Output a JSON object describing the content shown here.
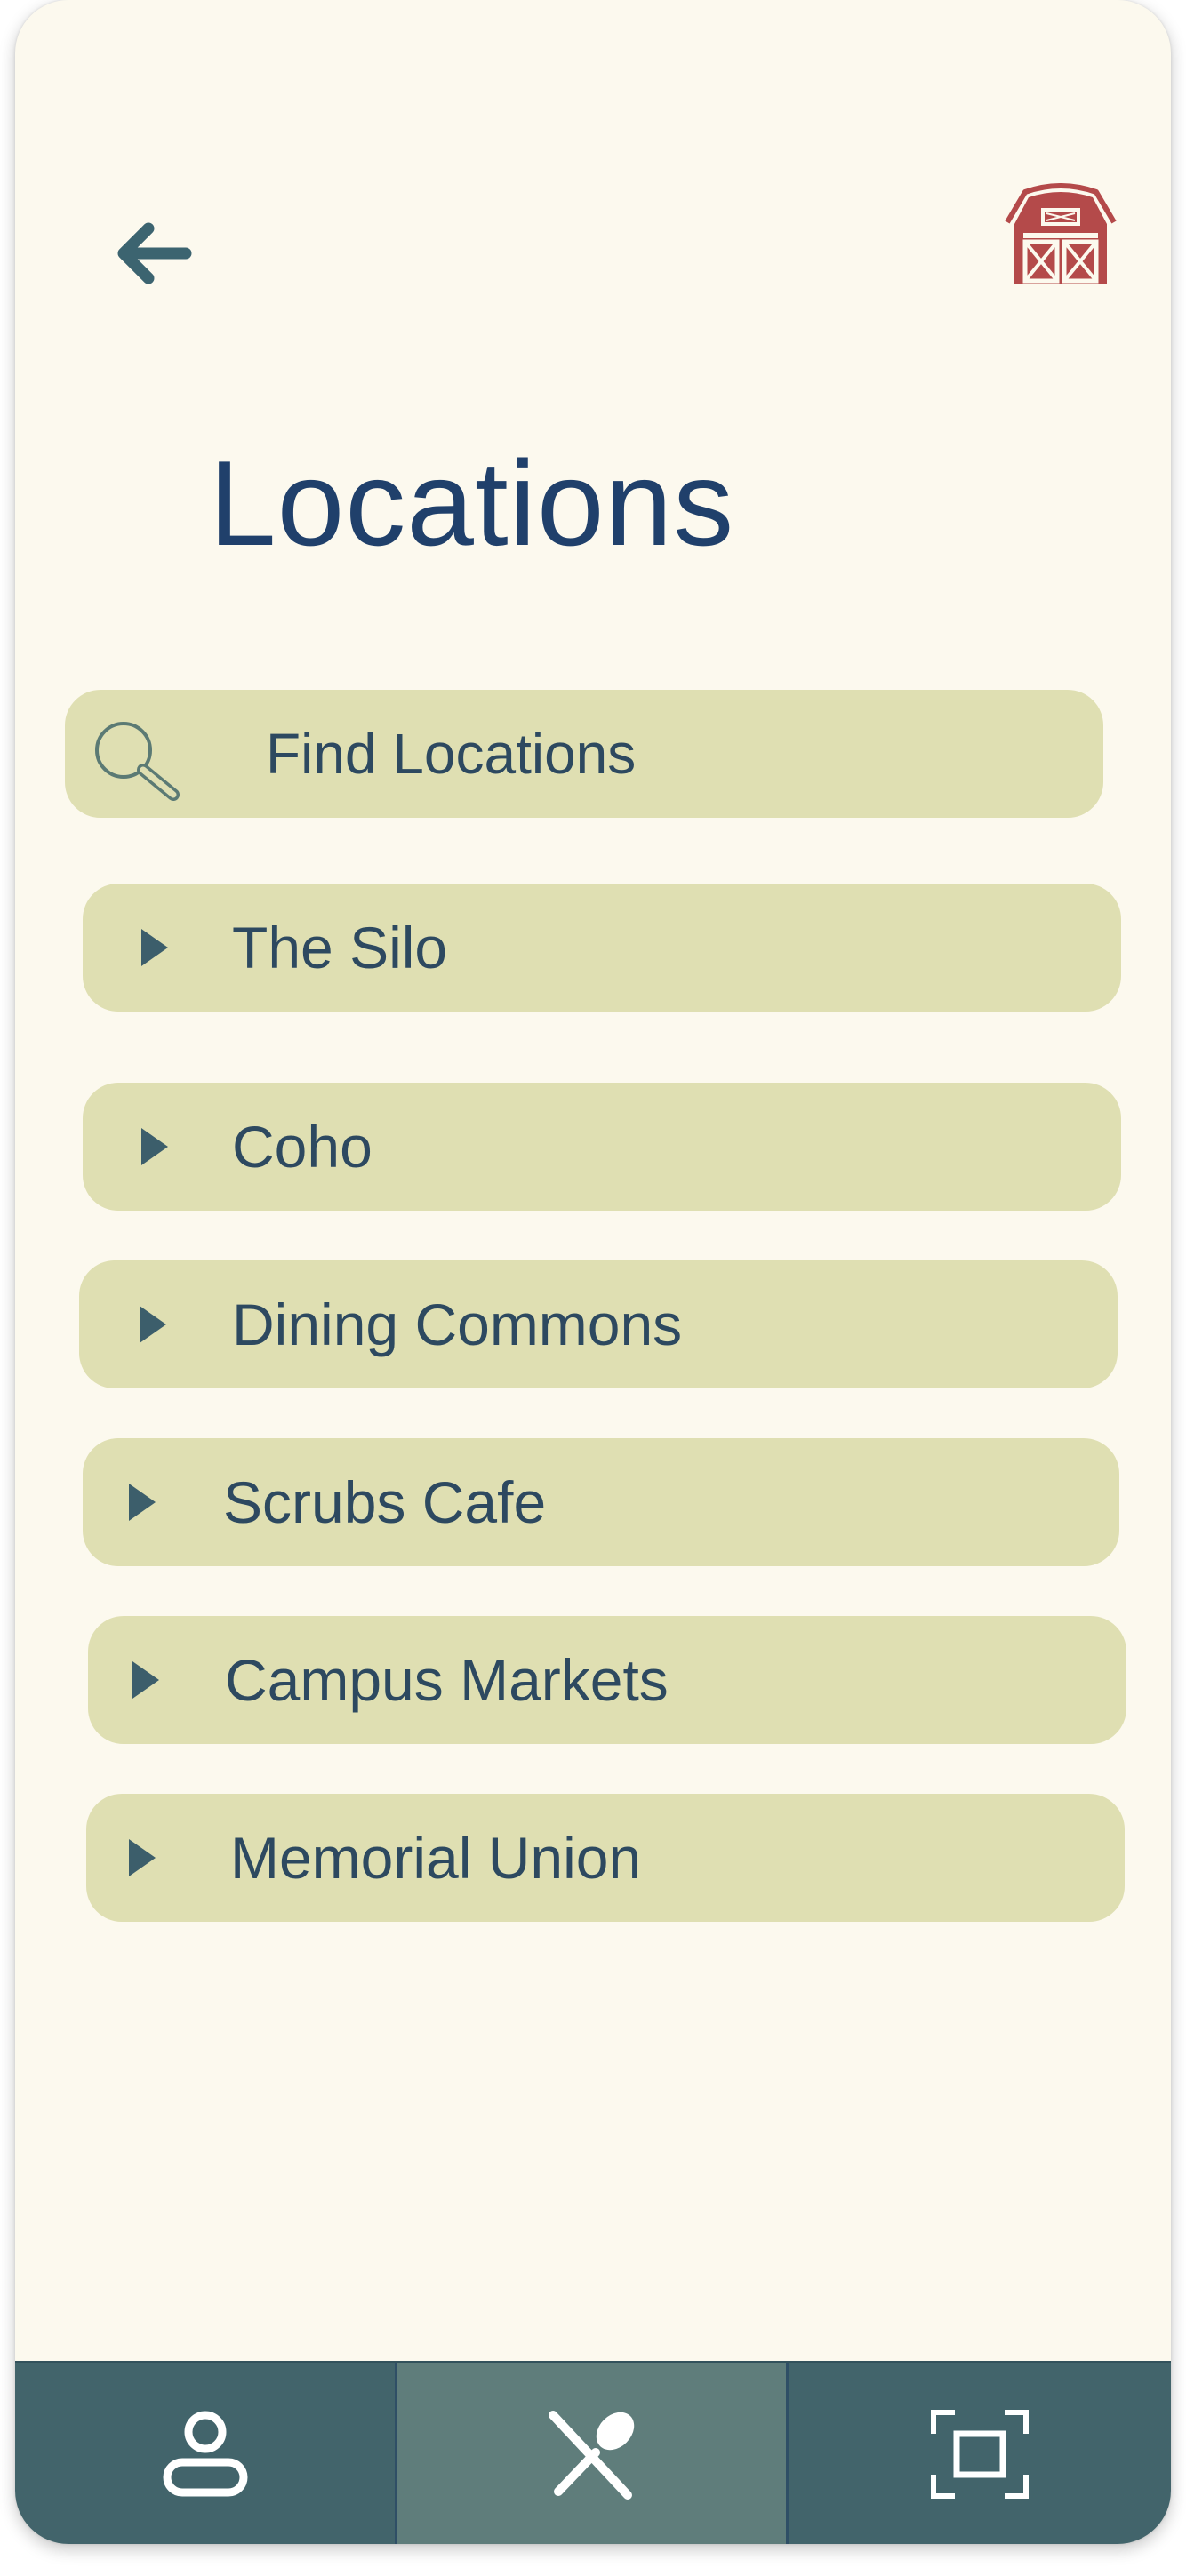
{
  "header": {
    "back_icon": "arrow-left-icon",
    "logo_icon": "barn-icon",
    "title": "Locations"
  },
  "search": {
    "icon": "search-icon",
    "placeholder": "Find Locations"
  },
  "locations": [
    {
      "label": "The Silo",
      "icon": "caret-right-icon"
    },
    {
      "label": "Coho",
      "icon": "caret-right-icon"
    },
    {
      "label": "Dining Commons",
      "icon": "caret-right-icon"
    },
    {
      "label": "Scrubs Cafe",
      "icon": "caret-right-icon"
    },
    {
      "label": "Campus Markets",
      "icon": "caret-right-icon"
    },
    {
      "label": "Memorial Union",
      "icon": "caret-right-icon"
    }
  ],
  "bottom_nav": {
    "tabs": [
      {
        "icon": "person-icon",
        "active": false
      },
      {
        "icon": "fork-spoon-icon",
        "active": true
      },
      {
        "icon": "scan-icon",
        "active": false
      }
    ]
  },
  "colors": {
    "background": "#fcf9ee",
    "title": "#20406b",
    "item_background": "#dfdfb2",
    "item_text": "#2d4960",
    "nav_background": "#42646b",
    "nav_active": "#5f7d7b",
    "logo": "#b44a4a"
  }
}
